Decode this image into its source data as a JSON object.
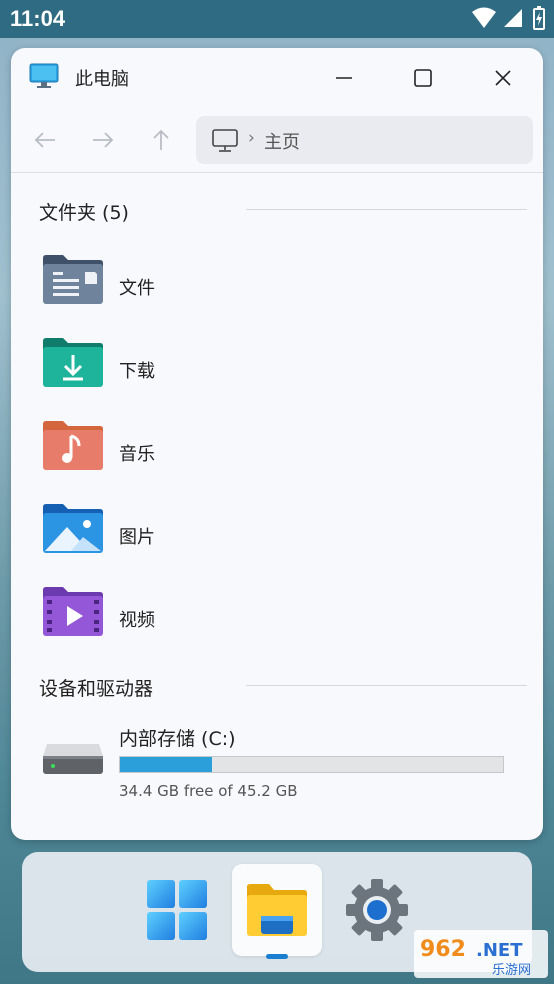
{
  "status": {
    "time": "11:04"
  },
  "window": {
    "title": "此电脑",
    "address": "主页",
    "address_sep": "›"
  },
  "folders_section": {
    "title": "文件夹 (5)",
    "items": [
      {
        "label": "文件",
        "icon": "documents-folder-icon",
        "color": "#5b6f87"
      },
      {
        "label": "下载",
        "icon": "downloads-folder-icon",
        "color": "#1a9e8a"
      },
      {
        "label": "音乐",
        "icon": "music-folder-icon",
        "color": "#e0715c"
      },
      {
        "label": "图片",
        "icon": "pictures-folder-icon",
        "color": "#1e86d6"
      },
      {
        "label": "视频",
        "icon": "videos-folder-icon",
        "color": "#8a4fcf"
      }
    ]
  },
  "drives_section": {
    "title": "设备和驱动器",
    "drive": {
      "name": "内部存储 (C:)",
      "free_text": "34.4 GB free of 45.2 GB",
      "used_fraction": 0.239
    }
  },
  "taskbar": {
    "apps": [
      {
        "name": "start",
        "icon": "windows-logo-icon"
      },
      {
        "name": "file-explorer",
        "icon": "file-explorer-icon",
        "active": true
      },
      {
        "name": "settings",
        "icon": "gear-icon"
      }
    ]
  },
  "watermark": {
    "main": "962.NET",
    "sub": "乐游网"
  }
}
